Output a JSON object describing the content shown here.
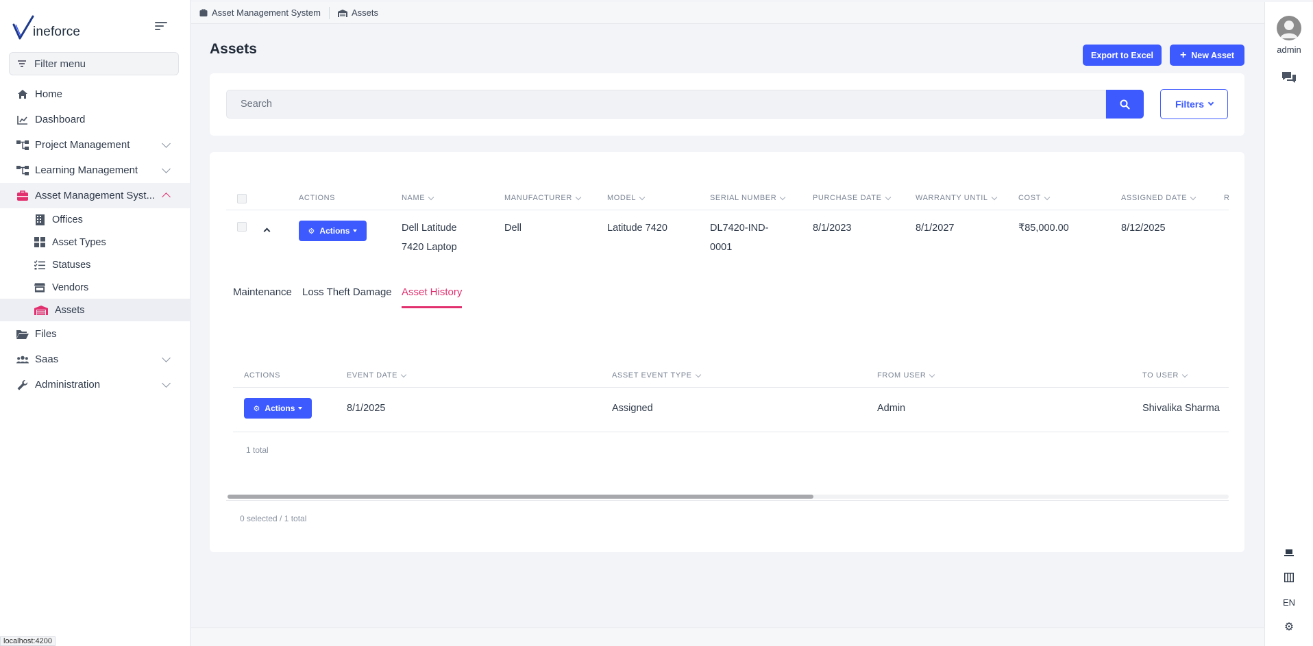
{
  "brand": {
    "logo_text": "ineforce",
    "accent": "#3d5afe",
    "active_color": "#e2306f"
  },
  "sidebar": {
    "filter_placeholder": "Filter menu",
    "items": [
      {
        "label": "Home",
        "icon": "home-icon"
      },
      {
        "label": "Dashboard",
        "icon": "chart-line-icon"
      },
      {
        "label": "Project Management",
        "icon": "sitemap-icon",
        "expandable": true
      },
      {
        "label": "Learning Management",
        "icon": "sitemap-icon",
        "expandable": true
      },
      {
        "label": "Asset Management Syst...",
        "icon": "toolbox-icon",
        "expanded": true
      },
      {
        "label": "Files",
        "icon": "folder-open-icon"
      },
      {
        "label": "Saas",
        "icon": "users-icon",
        "expandable": true
      },
      {
        "label": "Administration",
        "icon": "wrench-icon",
        "expandable": true
      }
    ],
    "sub_items": [
      {
        "label": "Offices",
        "icon": "building-icon"
      },
      {
        "label": "Asset Types",
        "icon": "grid-icon"
      },
      {
        "label": "Statuses",
        "icon": "list-check-icon"
      },
      {
        "label": "Vendors",
        "icon": "store-icon"
      },
      {
        "label": "Assets",
        "icon": "warehouse-icon",
        "active": true
      }
    ]
  },
  "breadcrumb": [
    {
      "label": "Asset Management System",
      "icon": "toolbox-icon"
    },
    {
      "label": "Assets",
      "icon": "warehouse-icon"
    }
  ],
  "header": {
    "title": "Assets",
    "export_label": "Export to Excel",
    "new_label": "New Asset"
  },
  "search": {
    "placeholder": "Search",
    "filters_label": "Filters"
  },
  "assets_table": {
    "columns": [
      "Actions",
      "Name",
      "Manufacturer",
      "Model",
      "Serial Number",
      "Purchase Date",
      "Warranty Until",
      "Cost",
      "Assigned Date",
      "R"
    ],
    "row": {
      "actions_label": "Actions",
      "name_line1": "Dell Latitude",
      "name_line2": "7420 Laptop",
      "manufacturer": "Dell",
      "model": "Latitude 7420",
      "serial_line1": "DL7420-IND-",
      "serial_line2": "0001",
      "purchase_date": "8/1/2023",
      "warranty_until": "8/1/2027",
      "cost": "₹85,000.00",
      "assigned_date": "8/12/2025"
    },
    "footer": "0 selected / 1 total",
    "scroll_fraction": 0.585
  },
  "detail_tabs": [
    {
      "label": "Maintenance"
    },
    {
      "label": "Loss Theft Damage"
    },
    {
      "label": "Asset History",
      "active": true
    }
  ],
  "history_table": {
    "columns": [
      "Actions",
      "Event Date",
      "Asset Event Type",
      "From User",
      "To User"
    ],
    "row": {
      "actions_label": "Actions",
      "event_date": "8/1/2025",
      "event_type": "Assigned",
      "from_user": "Admin",
      "to_user": "Shivalika Sharma"
    },
    "total": "1 total"
  },
  "right_rail": {
    "user": "admin",
    "language": "EN"
  },
  "status_bar": {
    "url": "localhost:4200"
  }
}
